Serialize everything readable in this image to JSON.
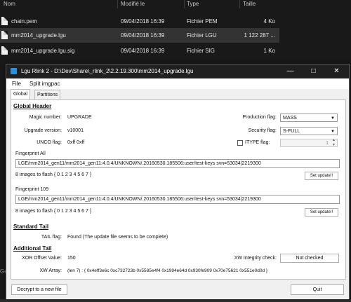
{
  "explorer": {
    "columns": {
      "name": "Nom",
      "modified": "Modifié le",
      "type": "Type",
      "size": "Taille"
    },
    "files": [
      {
        "name": "chain.pem",
        "modified": "09/04/2018 16:39",
        "type": "Fichier PEM",
        "size": "4 Ko",
        "selected": false
      },
      {
        "name": "mm2014_upgrade.lgu",
        "modified": "09/04/2018 16:39",
        "type": "Fichier LGU",
        "size": "1 122 287 ...",
        "selected": true
      },
      {
        "name": "mm2014_upgrade.lgu.sig",
        "modified": "09/04/2018 16:39",
        "type": "Fichier SIG",
        "size": "1 Ko",
        "selected": false
      }
    ],
    "side_label": "Ge"
  },
  "window": {
    "title": "Lgu Rlink 2 - D:\\Dev\\Share\\_rlink_2\\2.2.19.300\\mm2014_upgrade.lgu",
    "menu": [
      "File",
      "Split imgpac"
    ],
    "tabs": [
      "Global",
      "Partitions"
    ],
    "global_header": {
      "section": "Global Header",
      "magic_label": "Magic number:",
      "magic_value": "UPGRADE",
      "version_label": "Upgrade version:",
      "version_value": "v10001",
      "unco_label": "UNCO flag:",
      "unco_value": "0xff 0xff",
      "production_label": "Production flag:",
      "production_value": "MASS",
      "security_label": "Security flag:",
      "security_value": "S-FULL",
      "itype_label": "ITYPE flag:",
      "itype_value": "1",
      "fp_all_label": "Fingerprint All",
      "fp_all_value": "LGE/mm2014_gen11/mm2014_gen11:4.0.4/UNKNOWN/.20160530.185506:user/test-keys svn=53034|2219300",
      "fp_all_images": "8 images to flash { 0 1 2 3 4 5 6 7 }",
      "fp_109_label": "Fingerprint 109",
      "fp_109_value": "LGE/mm2014_gen11/mm2014_gen11:4.0.4/UNKNOWN/.20160530.185506:user/test-keys svn=53034|2219300",
      "fp_109_images": "8 images to flash { 0 1 2 3 4 5 6 7 }",
      "set_update_label": "Set update!!"
    },
    "standard_tail": {
      "section": "Standard Tail",
      "tail_label": "TAIL flag:",
      "tail_value": "Found (The update file seems to be complete)"
    },
    "additional_tail": {
      "section": "Additional Tail",
      "xor_label": "XOR Offset Value:",
      "xor_value": "150",
      "xw_integrity_label": "XW Integrity check:",
      "xw_integrity_button": "Not checked",
      "xw_array_label": "XW Array:",
      "xw_array_value": "(len 7) : { 0x4eff3e6c 0xc732723b 0x5585e4f4 0x1994e64d 0x930fe909 0x70e75621 0x551e0d0d }"
    },
    "footer": {
      "decrypt_button": "Decrypt to a new file",
      "quit_button": "Quit"
    }
  }
}
